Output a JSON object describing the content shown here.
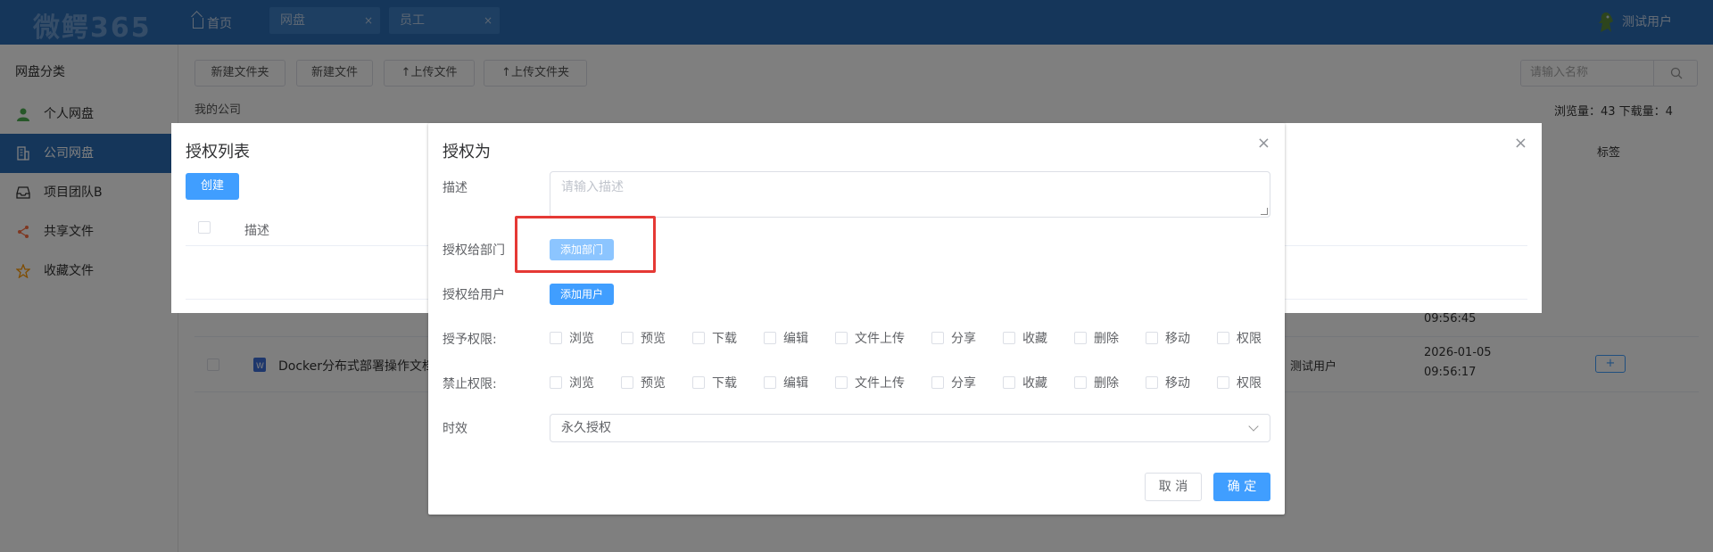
{
  "header": {
    "logo": "微鳄365",
    "home": "首页",
    "tabs": [
      {
        "label": "网盘"
      },
      {
        "label": "员工"
      }
    ],
    "close_glyph": "×",
    "user": "测试用户"
  },
  "sidebar": {
    "title": "网盘分类",
    "items": [
      {
        "label": "个人网盘",
        "icon": "user-icon",
        "active": false
      },
      {
        "label": "公司网盘",
        "icon": "building-icon",
        "active": true
      },
      {
        "label": "项目团队B",
        "icon": "inbox-icon",
        "active": false
      },
      {
        "label": "共享文件",
        "icon": "share-icon",
        "active": false
      },
      {
        "label": "收藏文件",
        "icon": "star-icon",
        "active": false
      }
    ]
  },
  "toolbar": {
    "new_folder": "新建文件夹",
    "new_file": "新建文件",
    "upload_file": "上传文件",
    "upload_folder": "上传文件夹",
    "search_placeholder": "请输入名称"
  },
  "breadcrumb": "我的公司",
  "stats": "浏览量：43  下载量：4",
  "background_table": {
    "tag_header": "标签",
    "rows": [
      {
        "time_line2": "09:56:45"
      },
      {
        "name": "Docker分布式部署操作文档",
        "owner": "测试用户",
        "time_line1": "2026-01-05",
        "time_line2": "09:56:17",
        "add": "+"
      }
    ]
  },
  "auth_list_dialog": {
    "title": "授权列表",
    "create": "创建",
    "col_desc": "描述",
    "close": "×"
  },
  "auth_dialog": {
    "title": "授权为",
    "close": "×",
    "desc_label": "描述",
    "desc_placeholder": "请输入描述",
    "dept_label": "授权给部门",
    "dept_button": "添加部门",
    "user_label": "授权给用户",
    "user_button": "添加用户",
    "grant_label": "授予权限:",
    "deny_label": "禁止权限:",
    "permissions": [
      "浏览",
      "预览",
      "下载",
      "编辑",
      "文件上传",
      "分享",
      "收藏",
      "删除",
      "移动",
      "权限"
    ],
    "validity_label": "时效",
    "validity_value": "永久授权",
    "cancel": "取 消",
    "ok": "确 定"
  },
  "colors": {
    "header_bg": "#2b6cb4",
    "primary": "#409eff",
    "highlight": "#e53935"
  }
}
